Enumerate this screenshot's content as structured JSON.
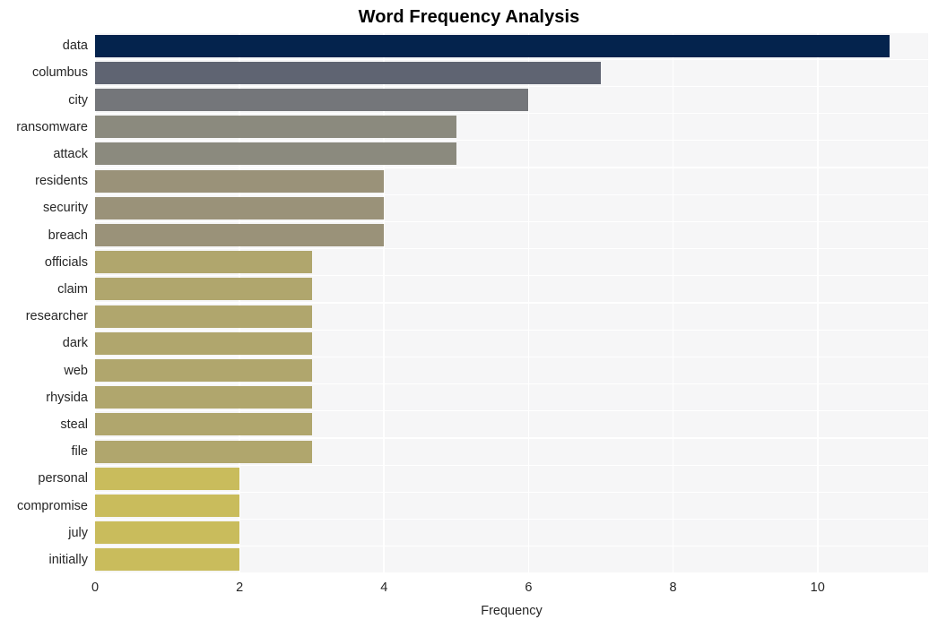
{
  "chart_data": {
    "type": "bar",
    "orientation": "horizontal",
    "title": "Word Frequency Analysis",
    "xlabel": "Frequency",
    "ylabel": "",
    "categories": [
      "data",
      "columbus",
      "city",
      "ransomware",
      "attack",
      "residents",
      "security",
      "breach",
      "officials",
      "claim",
      "researcher",
      "dark",
      "web",
      "rhysida",
      "steal",
      "file",
      "personal",
      "compromise",
      "july",
      "initially"
    ],
    "values": [
      11,
      7,
      6,
      5,
      5,
      4,
      4,
      4,
      3,
      3,
      3,
      3,
      3,
      3,
      3,
      3,
      2,
      2,
      2,
      2
    ],
    "bar_colors": [
      "#04234d",
      "#5f6472",
      "#74767a",
      "#8b8a7e",
      "#8b8a7e",
      "#9a9279",
      "#9a9279",
      "#9a9279",
      "#b0a66d",
      "#b0a66d",
      "#b0a66d",
      "#b0a66d",
      "#b0a66d",
      "#b0a66d",
      "#b0a66d",
      "#b0a66d",
      "#c9bc5c",
      "#c9bc5c",
      "#c9bc5c",
      "#c9bc5c"
    ],
    "xlim": [
      0,
      11.53
    ],
    "xticks": [
      0,
      2,
      4,
      6,
      8,
      10
    ],
    "xtick_labels": [
      "0",
      "2",
      "4",
      "6",
      "8",
      "10"
    ],
    "grid": "vertical-and-horizontal",
    "legend": "none",
    "plot_background": "#f6f6f7",
    "figure_background": "#ffffff",
    "gridline_color": "#ffffff",
    "tick_label_color": "#262626",
    "title_color": "#000000"
  }
}
